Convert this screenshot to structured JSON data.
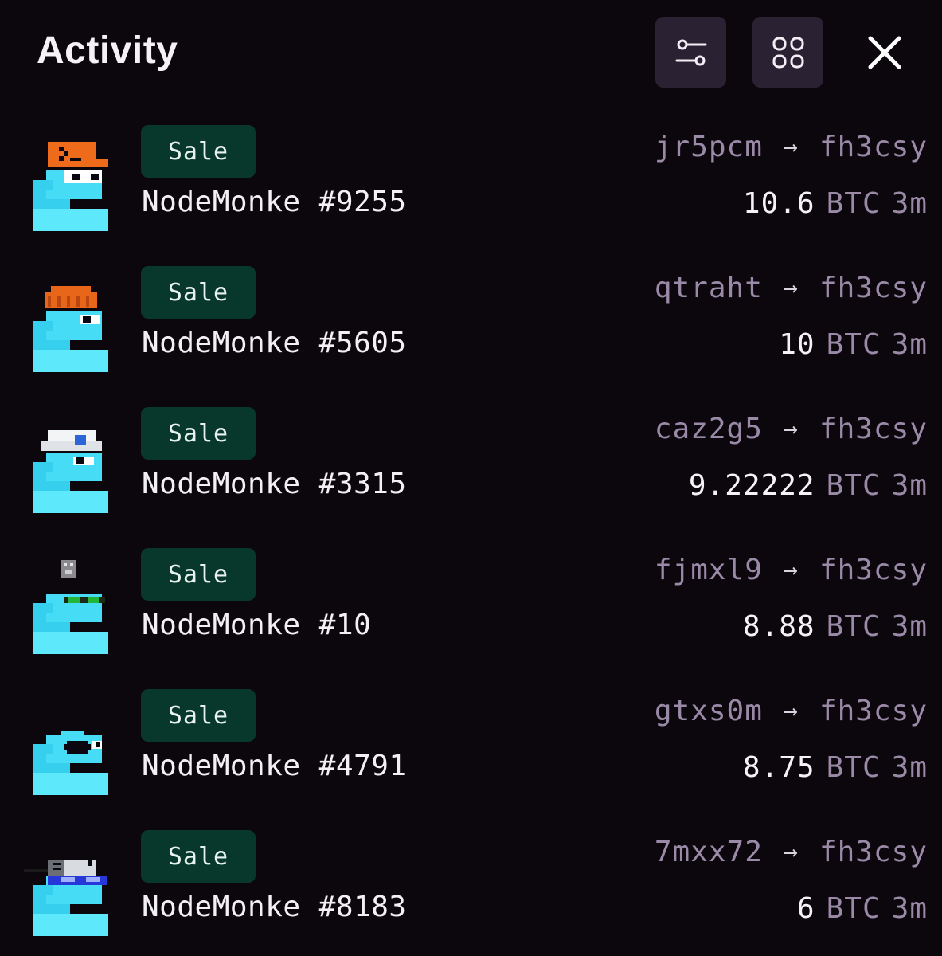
{
  "header": {
    "title": "Activity",
    "filter_icon": "sliders-icon",
    "grid_icon": "grid-icon",
    "close_icon": "close-icon"
  },
  "colors": {
    "background": "#0b070d",
    "badge_bg": "#07382b",
    "muted_text": "#9a8aa8",
    "button_bg": "#2a2233"
  },
  "activity": [
    {
      "type": "Sale",
      "name": "NodeMonke #9255",
      "from": "jr5pcm",
      "to": "fh3csy",
      "amount": "10.6",
      "unit": "BTC",
      "age": "3m",
      "avatar": "monke-orange-cap-avatar"
    },
    {
      "type": "Sale",
      "name": "NodeMonke #5605",
      "from": "qtraht",
      "to": "fh3csy",
      "amount": "10",
      "unit": "BTC",
      "age": "3m",
      "avatar": "monke-beanie-avatar"
    },
    {
      "type": "Sale",
      "name": "NodeMonke #3315",
      "from": "caz2g5",
      "to": "fh3csy",
      "amount": "9.22222",
      "unit": "BTC",
      "age": "3m",
      "avatar": "monke-white-cap-avatar"
    },
    {
      "type": "Sale",
      "name": "NodeMonke #10",
      "from": "fjmxl9",
      "to": "fh3csy",
      "amount": "8.88",
      "unit": "BTC",
      "age": "3m",
      "avatar": "monke-green-shades-avatar"
    },
    {
      "type": "Sale",
      "name": "NodeMonke #4791",
      "from": "gtxs0m",
      "to": "fh3csy",
      "amount": "8.75",
      "unit": "BTC",
      "age": "3m",
      "avatar": "monke-eyepatch-avatar"
    },
    {
      "type": "Sale",
      "name": "NodeMonke #8183",
      "from": "7mxx72",
      "to": "fh3csy",
      "amount": "6",
      "unit": "BTC",
      "age": "3m",
      "avatar": "monke-blue-glasses-avatar"
    }
  ]
}
